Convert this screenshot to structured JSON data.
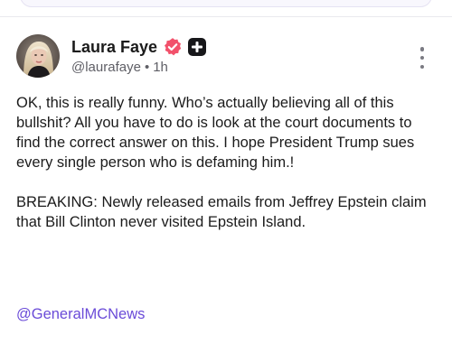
{
  "post": {
    "author_name": "Laura Faye",
    "handle": "@laurafaye",
    "separator": "•",
    "time": "1h",
    "paragraphs": [
      "OK, this is really funny. Who’s actually believing all of this bullshit? All you have to do is look at the court documents to find the correct answer on this. I hope President Trump sues every single person who is defaming him.!",
      "BREAKING: Newly released emails from Jeffrey Epstein claim that Bill Clinton never visited Epstein Island."
    ],
    "mention": "@GeneralMCNews"
  },
  "icons": {
    "verified": "verified-badge-icon",
    "plus": "plus-badge-icon",
    "more": "more-vertical-icon"
  },
  "colors": {
    "verified_badge": "#f2516b",
    "plus_badge": "#17171a",
    "link": "#6a4bd8",
    "secondary_text": "#5f5f66"
  }
}
